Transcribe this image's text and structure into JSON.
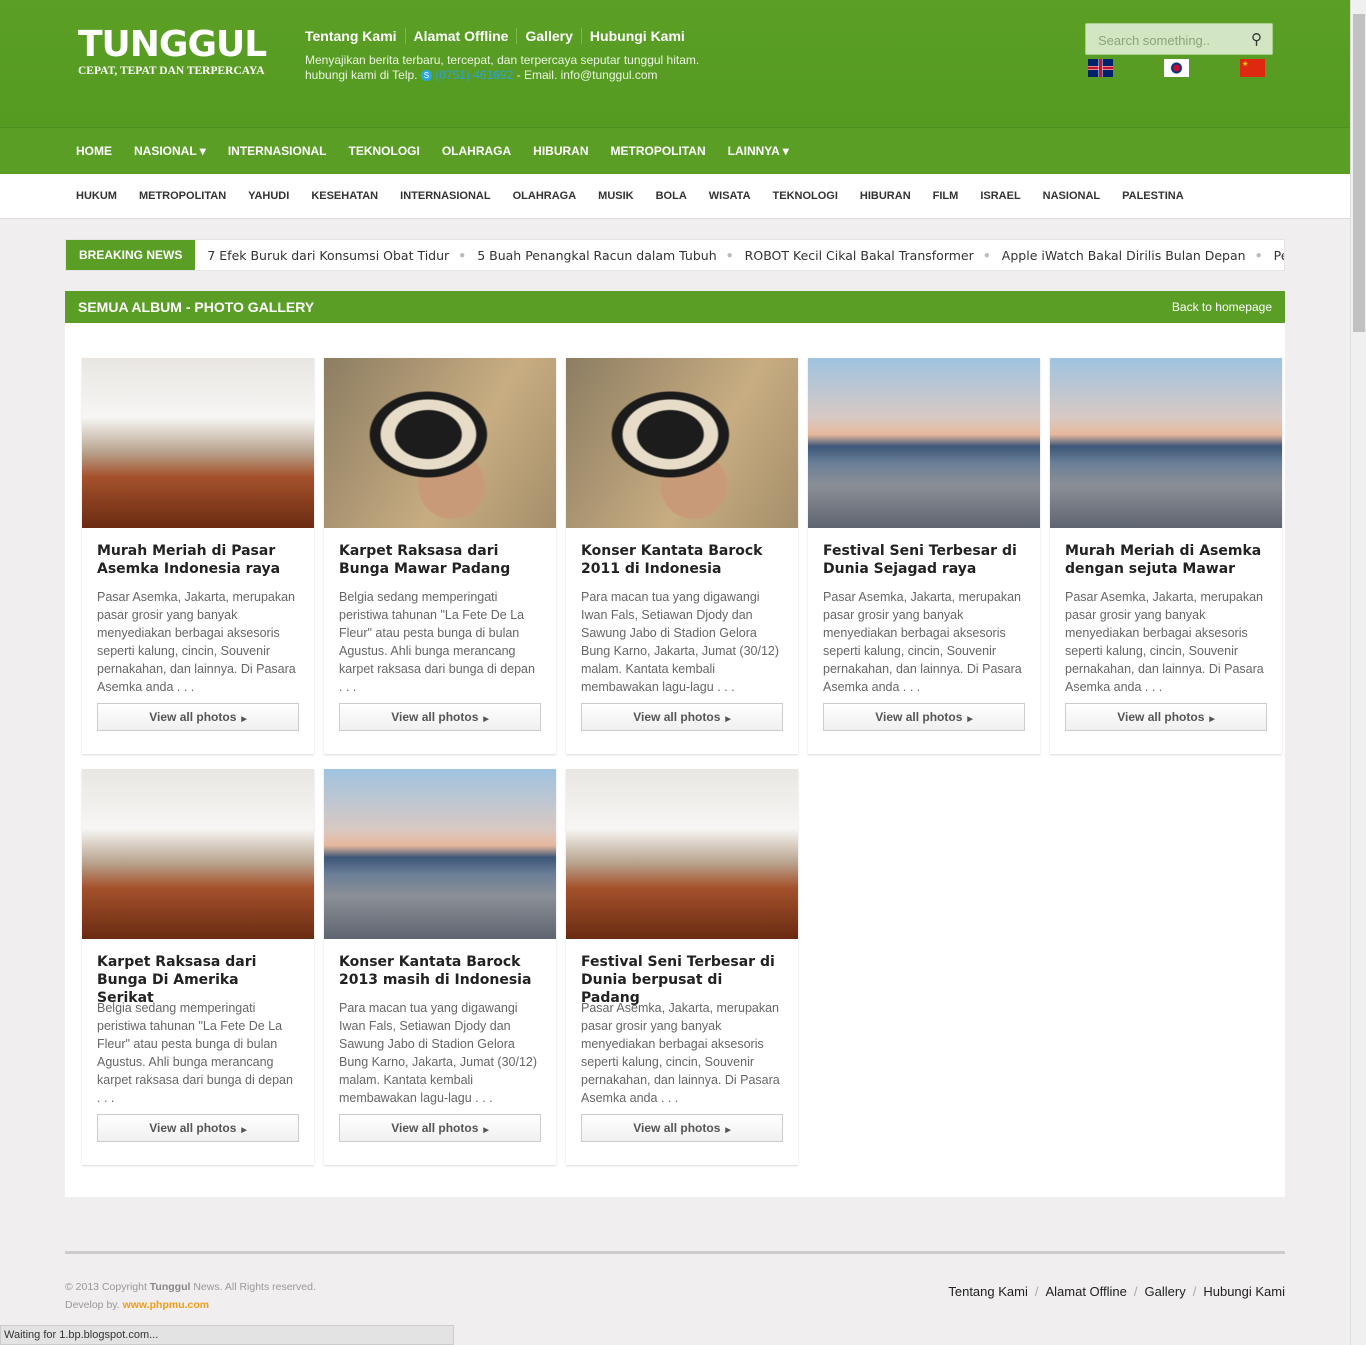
{
  "header": {
    "logo": "TUNGGUL",
    "slogan": "CEPAT, TEPAT DAN TERPERCAYA",
    "top_links": [
      "Tentang Kami",
      "Alamat Offline",
      "Gallery",
      "Hubungi Kami"
    ],
    "tagline": "Menyajikan berita terbaru, tercepat, dan terpercaya seputar tunggul hitam.",
    "contact_prefix": "hubungi kami di Telp.",
    "phone": "(0751) 461692",
    "email": "- Email. info@tunggul.com",
    "search_placeholder": "Search something..",
    "flags": [
      "uk-flag",
      "korea-flag",
      "china-flag"
    ]
  },
  "nav": [
    "HOME",
    "NASIONAL ▾",
    "INTERNASIONAL",
    "TEKNOLOGI",
    "OLAHRAGA",
    "HIBURAN",
    "METROPOLITAN",
    "LAINNYA ▾"
  ],
  "subnav": [
    "HUKUM",
    "METROPOLITAN",
    "YAHUDI",
    "KESEHATAN",
    "INTERNASIONAL",
    "OLAHRAGA",
    "MUSIK",
    "BOLA",
    "WISATA",
    "TEKNOLOGI",
    "HIBURAN",
    "FILM",
    "ISRAEL",
    "NASIONAL",
    "PALESTINA"
  ],
  "breaking": {
    "label": "BREAKING NEWS",
    "items": [
      "7 Efek Buruk dari Konsumsi Obat Tidur",
      "5 Buah Penangkal Racun dalam Tubuh",
      "ROBOT Kecil Cikal Bakal Transformer",
      "Apple iWatch Bakal Dirilis Bulan Depan",
      "Pentax Q-S"
    ]
  },
  "gallery": {
    "title": "SEMUA ALBUM - PHOTO GALLERY",
    "back": "Back to homepage",
    "button": "View all photos",
    "albums": [
      {
        "img": "interior",
        "title": "Murah Meriah di Pasar Asemka Indonesia raya",
        "desc": "Pasar Asemka, Jakarta, merupakan pasar grosir yang banyak menyediakan berbagai aksesoris seperti kalung, cincin, Souvenir pernakahan, dan lainnya. Di Pasara Asemka anda . . ."
      },
      {
        "img": "woman",
        "title": "Karpet Raksasa dari Bunga Mawar Padang",
        "desc": "Belgia sedang memperingati peristiwa tahunan \"La Fete De La Fleur\" atau pesta bunga di bulan Agustus. Ahli bunga merancang karpet raksasa dari bunga di depan . . ."
      },
      {
        "img": "woman",
        "title": "Konser Kantata Barock 2011 di Indonesia",
        "desc": "Para macan tua yang digawangi Iwan Fals, Setiawan Djody dan Sawung Jabo di Stadion Gelora Bung Karno, Jakarta, Jumat (30/12) malam. Kantata kembali membawakan lagu-lagu . . ."
      },
      {
        "img": "city",
        "title": "Festival Seni Terbesar di Dunia Sejagad raya",
        "desc": "Pasar Asemka, Jakarta, merupakan pasar grosir yang banyak menyediakan berbagai aksesoris seperti kalung, cincin, Souvenir pernakahan, dan lainnya. Di Pasara Asemka anda . . ."
      },
      {
        "img": "city",
        "title": "Murah Meriah di Asemka dengan sejuta Mawar",
        "desc": "Pasar Asemka, Jakarta, merupakan pasar grosir yang banyak menyediakan berbagai aksesoris seperti kalung, cincin, Souvenir pernakahan, dan lainnya. Di Pasara Asemka anda . . ."
      },
      {
        "img": "interior",
        "title": "Karpet Raksasa dari Bunga Di Amerika Serikat",
        "desc": "Belgia sedang memperingati peristiwa tahunan \"La Fete De La Fleur\" atau pesta bunga di bulan Agustus. Ahli bunga merancang karpet raksasa dari bunga di depan . . ."
      },
      {
        "img": "city",
        "title": "Konser Kantata Barock 2013 masih di Indonesia",
        "desc": "Para macan tua yang digawangi Iwan Fals, Setiawan Djody dan Sawung Jabo di Stadion Gelora Bung Karno, Jakarta, Jumat (30/12) malam. Kantata kembali membawakan lagu-lagu . . ."
      },
      {
        "img": "interior",
        "title": "Festival Seni Terbesar di Dunia berpusat di Padang",
        "desc": "Pasar Asemka, Jakarta, merupakan pasar grosir yang banyak menyediakan berbagai aksesoris seperti kalung, cincin, Souvenir pernakahan, dan lainnya. Di Pasara Asemka anda . . ."
      }
    ]
  },
  "footer": {
    "copy_pre": "© 2013 Copyright",
    "copy_brand": "Tunggul",
    "copy_post": "News. All Rights reserved.",
    "dev_label": "Develop by.",
    "dev_link": "www.phpmu.com",
    "links": [
      "Tentang Kami",
      "Alamat Offline",
      "Gallery",
      "Hubungi Kami"
    ]
  },
  "status_bar": "Waiting for 1.bp.blogspot.com..."
}
